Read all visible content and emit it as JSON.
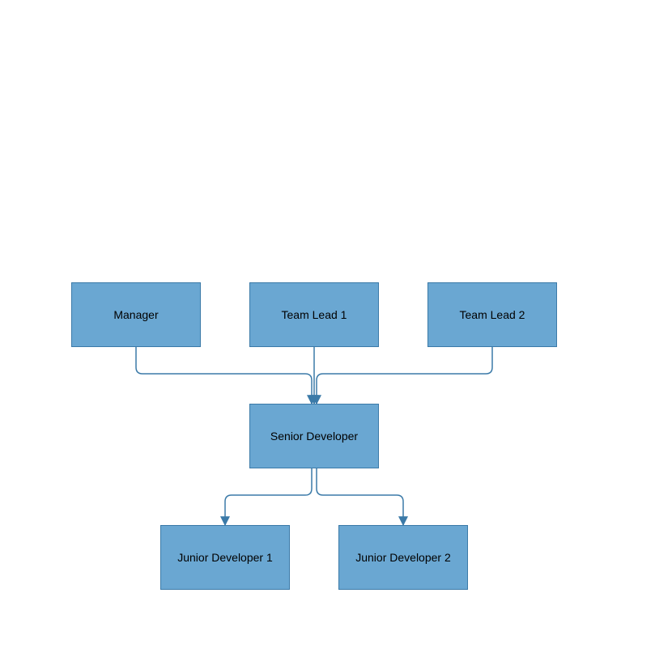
{
  "diagram": {
    "type": "org-chart",
    "colors": {
      "node_fill": "#6aa7d2",
      "node_border": "#3b7aa8",
      "connector": "#3b7aa8"
    },
    "nodes": {
      "manager": {
        "label": "Manager"
      },
      "team_lead_1": {
        "label": "Team Lead 1"
      },
      "team_lead_2": {
        "label": "Team Lead 2"
      },
      "senior_dev": {
        "label": "Senior Developer"
      },
      "junior_dev_1": {
        "label": "Junior Developer 1"
      },
      "junior_dev_2": {
        "label": "Junior Developer 2"
      }
    },
    "edges": [
      {
        "from": "manager",
        "to": "senior_dev"
      },
      {
        "from": "team_lead_1",
        "to": "senior_dev"
      },
      {
        "from": "team_lead_2",
        "to": "senior_dev"
      },
      {
        "from": "senior_dev",
        "to": "junior_dev_1"
      },
      {
        "from": "senior_dev",
        "to": "junior_dev_2"
      }
    ]
  }
}
